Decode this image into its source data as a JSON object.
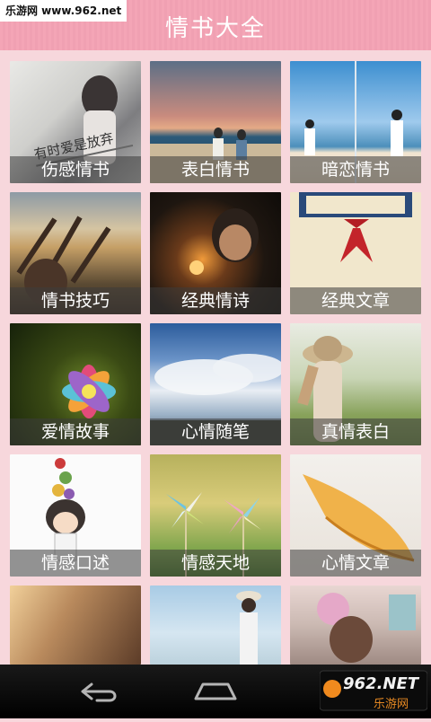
{
  "watermark": "乐游网 www.962.net",
  "header": {
    "title": "情书大全"
  },
  "tiles": [
    {
      "label": "伤感情书",
      "icon": "photo-icon"
    },
    {
      "label": "表白情书",
      "icon": "photo-icon"
    },
    {
      "label": "暗恋情书",
      "icon": "photo-icon"
    },
    {
      "label": "情书技巧",
      "icon": "photo-icon"
    },
    {
      "label": "经典情诗",
      "icon": "photo-icon"
    },
    {
      "label": "经典文章",
      "icon": "photo-icon"
    },
    {
      "label": "爱情故事",
      "icon": "photo-icon"
    },
    {
      "label": "心情随笔",
      "icon": "photo-icon"
    },
    {
      "label": "真情表白",
      "icon": "photo-icon"
    },
    {
      "label": "情感口述",
      "icon": "photo-icon"
    },
    {
      "label": "情感天地",
      "icon": "photo-icon"
    },
    {
      "label": "心情文章",
      "icon": "photo-icon"
    },
    {
      "label": "",
      "icon": "photo-icon"
    },
    {
      "label": "",
      "icon": "photo-icon"
    },
    {
      "label": "",
      "icon": "photo-icon"
    }
  ],
  "tile1_overlay": "有时爱是放弃",
  "nav": {
    "back": "back-icon",
    "home": "home-icon"
  },
  "brand": {
    "name": "962.NET",
    "sub": "乐游网"
  },
  "colors": {
    "header": "#f2a3b4",
    "background": "#f7d7dc",
    "navbar": "#000000"
  }
}
